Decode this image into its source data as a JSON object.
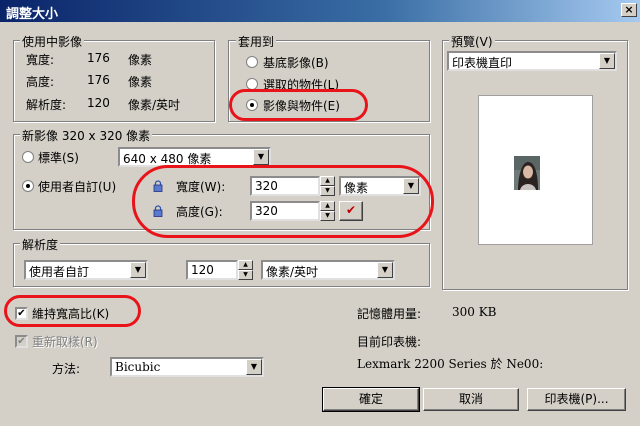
{
  "window": {
    "title": "調整大小",
    "close_glyph": "×"
  },
  "current_size": {
    "legend": "使用中影像",
    "rows": [
      {
        "label": "寬度:",
        "value": "176",
        "unit": "像素"
      },
      {
        "label": "高度:",
        "value": "176",
        "unit": "像素"
      },
      {
        "label": "解析度:",
        "value": "120",
        "unit": "像素/英吋"
      }
    ]
  },
  "apply_to": {
    "legend": "套用到",
    "options": [
      {
        "label": "基底影像(B)",
        "selected": false
      },
      {
        "label": "選取的物件(L)",
        "selected": false
      },
      {
        "label": "影像與物件(E)",
        "selected": true
      }
    ]
  },
  "new_image": {
    "legend": "新影像 320 x 320 像素",
    "standard_label": "標準(S)",
    "standard_value": "640 x 480 像素",
    "custom_label": "使用者自訂(U)",
    "width_label": "寬度(W):",
    "width_value": "320",
    "width_unit": "像素",
    "height_label": "高度(G):",
    "height_value": "320",
    "link_glyph": "✔"
  },
  "resolution": {
    "legend": "解析度",
    "preset": "使用者自訂",
    "value": "120",
    "unit": "像素/英吋"
  },
  "preview": {
    "legend": "預覽(V)",
    "select_value": "印表機直印"
  },
  "keep_aspect": {
    "label": "維持寬高比(K)",
    "checked": true,
    "glyph": "✔"
  },
  "resample": {
    "label": "重新取樣(R)",
    "checked": true,
    "enabled": false,
    "method_label": "方法:",
    "method_value": "Bicubic"
  },
  "info": {
    "memory_label": "記憶體用量:",
    "memory_value": "300 KB",
    "printer_label": "目前印表機:",
    "printer_value": "Lexmark 2200 Series 於 Ne00:"
  },
  "buttons": {
    "ok": "確定",
    "cancel": "取消",
    "printer": "印表機(P)..."
  },
  "accent": {
    "annotation": "#e8141a",
    "titlebar": "#0a246a"
  }
}
